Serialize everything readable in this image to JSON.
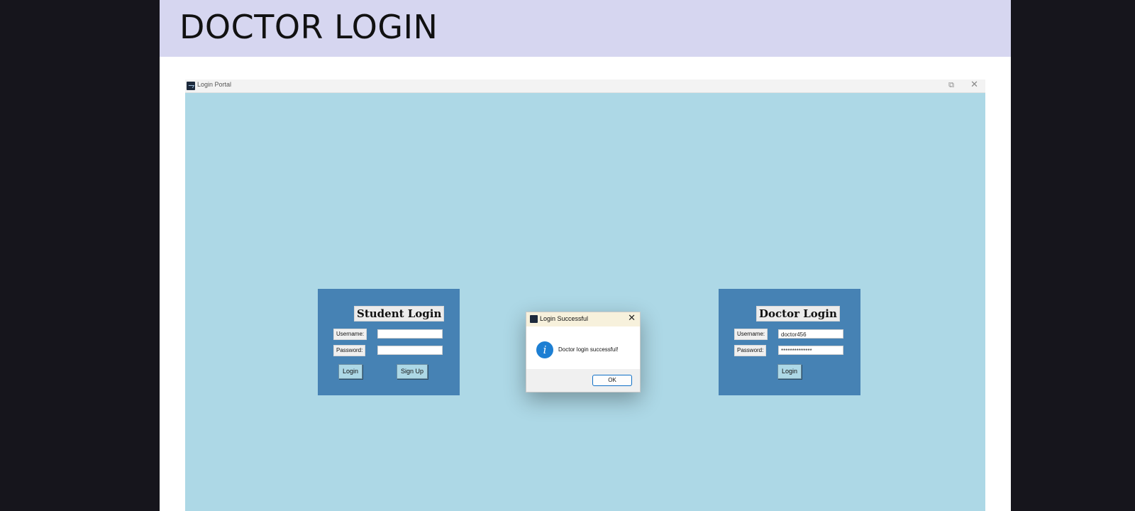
{
  "slide": {
    "title": "DOCTOR LOGIN"
  },
  "window": {
    "title": "Login Portal",
    "icon": "app-icon",
    "controls": {
      "restore_icon": "restore-icon",
      "close_icon": "close-icon"
    },
    "background_color": "#add8e6"
  },
  "student_panel": {
    "heading": "Student Login",
    "username_label": "Username:",
    "username_value": "",
    "password_label": "Password:",
    "password_value": "",
    "login_button": "Login",
    "signup_button": "Sign Up",
    "panel_color": "#4682b4"
  },
  "doctor_panel": {
    "heading": "Doctor Login",
    "username_label": "Username:",
    "username_value": "doctor456",
    "password_label": "Password:",
    "password_value": "**************",
    "login_button": "Login",
    "panel_color": "#4682b4"
  },
  "dialog": {
    "title": "Login Successful",
    "message": "Doctor login successful!",
    "ok_button": "OK",
    "info_icon": "info-icon",
    "accent_color": "#1d7fd3"
  }
}
